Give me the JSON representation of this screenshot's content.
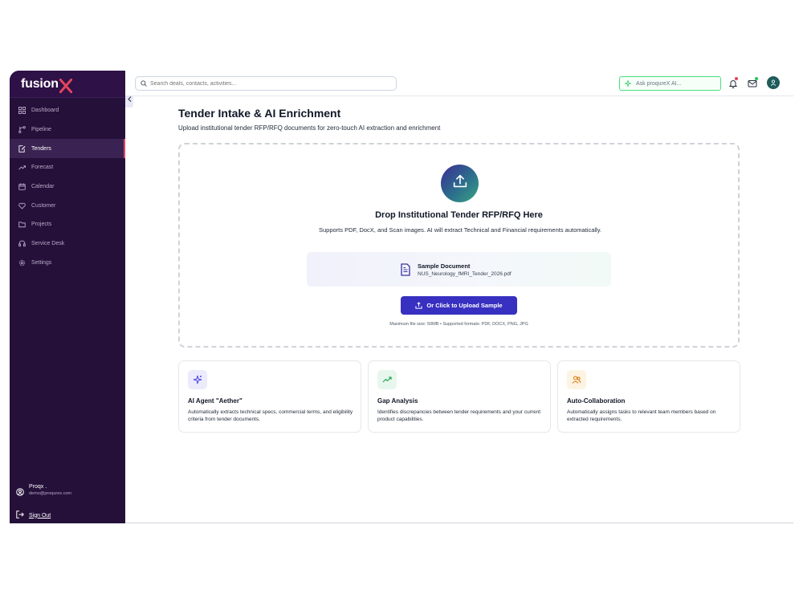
{
  "brand": {
    "name": "fusion",
    "accent": "#e0455d"
  },
  "sidebar": {
    "items": [
      {
        "label": "Dashboard",
        "icon": "grid-icon"
      },
      {
        "label": "Pipeline",
        "icon": "branch-icon"
      },
      {
        "label": "Tenders",
        "icon": "file-edit-icon",
        "active": true
      },
      {
        "label": "Forecast",
        "icon": "trend-icon"
      },
      {
        "label": "Calendar",
        "icon": "calendar-icon"
      },
      {
        "label": "Customer",
        "icon": "heart-icon"
      },
      {
        "label": "Projects",
        "icon": "folder-icon"
      },
      {
        "label": "Service Desk",
        "icon": "headset-icon"
      },
      {
        "label": "Settings",
        "icon": "gear-icon"
      }
    ],
    "user": {
      "name": "Proqx .",
      "email": "demo@proqurex.com"
    },
    "signout_label": "Sign Out"
  },
  "topbar": {
    "search_placeholder": "Search deals, contacts, activities...",
    "ask_ai_label": "Ask proqureX AI..."
  },
  "main": {
    "title": "Tender Intake & AI Enrichment",
    "subtitle": "Upload institutional tender RFP/RFQ documents for zero-touch AI extraction and enrichment",
    "dropzone": {
      "title": "Drop Institutional Tender RFP/RFQ Here",
      "description": "Supports PDF, DocX, and Scan images. AI will extract Technical and Financial requirements automatically.",
      "sample_title": "Sample Document",
      "sample_file": "NUS_Neurology_fMRI_Tender_2026.pdf",
      "upload_button": "Or Click to Upload Sample",
      "max_size": "Maximum file size: 50MB • Supported formats: PDF, DOCX, PNG, JPG"
    },
    "features": [
      {
        "title": "AI Agent \"Aether\"",
        "description": "Automatically extracts technical specs, commercial terms, and eligibility criteria from tender documents.",
        "icon": "sparkle-icon",
        "color": "#4f46e5",
        "bg": "#ecebfb"
      },
      {
        "title": "Gap Analysis",
        "description": "Identifies discrepancies between tender requirements and your current product capabilities.",
        "icon": "trend-up-icon",
        "color": "#16a34a",
        "bg": "#e8f7ee"
      },
      {
        "title": "Auto-Collaboration",
        "description": "Automatically assigns tasks to relevant team members based on extracted requirements.",
        "icon": "users-icon",
        "color": "#d97706",
        "bg": "#fdf3e3"
      }
    ]
  }
}
